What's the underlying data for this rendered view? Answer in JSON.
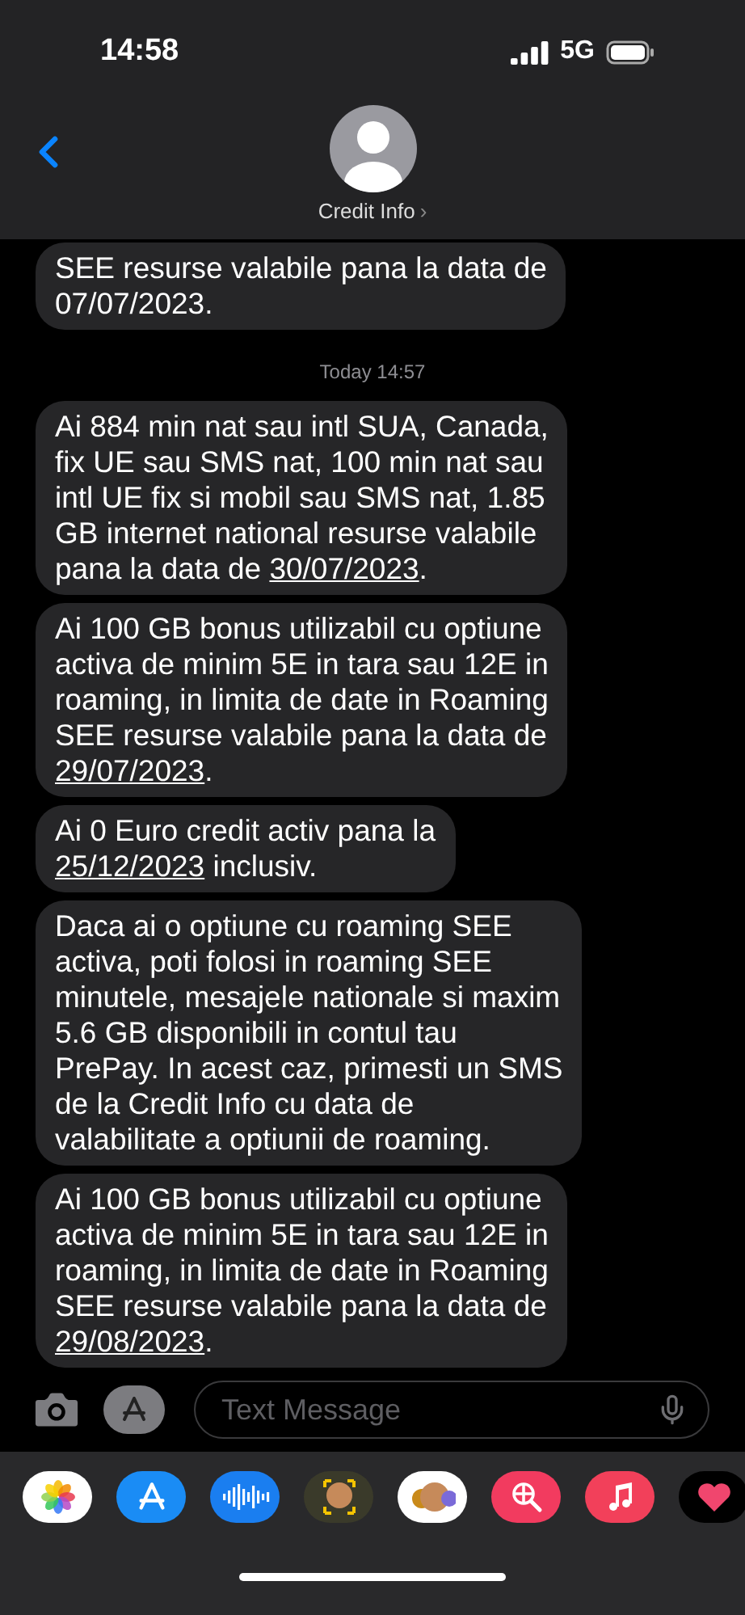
{
  "status_bar": {
    "time": "14:58",
    "network": "5G"
  },
  "header": {
    "contact": "Credit Info",
    "chevron": "›"
  },
  "messages": [
    {
      "kind": "bubble",
      "segments": [
        {
          "kind": "text",
          "text": "SEE resurse valabile pana la data de\n07/07/2023."
        }
      ]
    },
    {
      "kind": "timestamp",
      "segments": [
        {
          "kind": "text",
          "text": "Today 14:57"
        }
      ]
    },
    {
      "kind": "bubble",
      "segments": [
        {
          "kind": "text",
          "text": "Ai 884 min nat sau intl SUA, Canada,\nfix UE sau SMS nat, 100 min nat sau\nintl UE fix si mobil sau SMS nat, 1.85\nGB internet national resurse valabile\npana la data de "
        },
        {
          "kind": "link",
          "text": "30/07/2023"
        },
        {
          "kind": "text",
          "text": "."
        }
      ]
    },
    {
      "kind": "bubble",
      "segments": [
        {
          "kind": "text",
          "text": "Ai 100 GB bonus utilizabil cu optiune\nactiva de minim 5E in tara sau 12E in\nroaming, in limita de date in Roaming\nSEE resurse valabile pana la data de\n"
        },
        {
          "kind": "link",
          "text": "29/07/2023"
        },
        {
          "kind": "text",
          "text": "."
        }
      ]
    },
    {
      "kind": "bubble",
      "segments": [
        {
          "kind": "text",
          "text": "Ai 0 Euro credit activ pana la\n"
        },
        {
          "kind": "link",
          "text": "25/12/2023"
        },
        {
          "kind": "text",
          "text": " inclusiv."
        }
      ]
    },
    {
      "kind": "bubble",
      "segments": [
        {
          "kind": "text",
          "text": "Daca ai o optiune cu roaming SEE\nactiva, poti folosi in roaming SEE\nminutele, mesajele nationale si maxim\n5.6 GB disponibili in contul tau\nPrePay. In acest caz, primesti un SMS\nde la Credit Info cu data de\nvalabilitate a optiunii de roaming."
        }
      ]
    },
    {
      "kind": "bubble",
      "segments": [
        {
          "kind": "text",
          "text": "Ai 100 GB bonus utilizabil cu optiune\nactiva de minim 5E in tara sau 12E in\nroaming, in limita de date in Roaming\nSEE resurse valabile pana la data de\n"
        },
        {
          "kind": "link",
          "text": "29/08/2023"
        },
        {
          "kind": "text",
          "text": "."
        }
      ]
    }
  ],
  "composer": {
    "placeholder": "Text Message"
  }
}
